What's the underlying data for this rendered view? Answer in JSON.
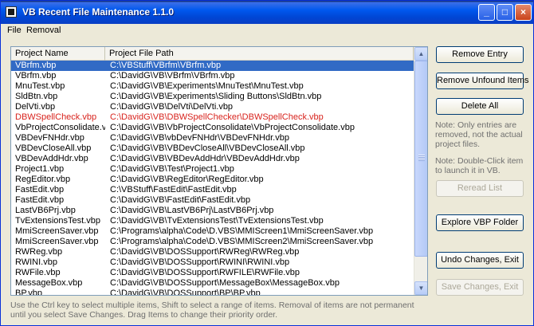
{
  "window": {
    "title": "VB Recent File Maintenance 1.1.0"
  },
  "titlebar_buttons": {
    "minimize": "_",
    "maximize": "□",
    "close": "×"
  },
  "menu": {
    "file": "File",
    "removal": "Removal"
  },
  "list": {
    "columns": [
      "Project Name",
      "Project File Path"
    ],
    "rows": [
      {
        "name": "VBrfm.vbp",
        "path": "C:\\VBStuff\\VBrfm\\VBrfm.vbp",
        "selected": true,
        "red": false
      },
      {
        "name": "VBrfm.vbp",
        "path": "C:\\DavidG\\VB\\VBrfm\\VBrfm.vbp",
        "selected": false,
        "red": false
      },
      {
        "name": "MnuTest.vbp",
        "path": "C:\\DavidG\\VB\\Experiments\\MnuTest\\MnuTest.vbp",
        "selected": false,
        "red": false
      },
      {
        "name": "SldBtn.vbp",
        "path": "C:\\DavidG\\VB\\Experiments\\Sliding Buttons\\SldBtn.vbp",
        "selected": false,
        "red": false
      },
      {
        "name": "DelVti.vbp",
        "path": "C:\\DavidG\\VB\\DelVti\\DelVti.vbp",
        "selected": false,
        "red": false
      },
      {
        "name": "DBWSpellCheck.vbp",
        "path": "C:\\DavidG\\VB\\DBWSpellChecker\\DBWSpellCheck.vbp",
        "selected": false,
        "red": true
      },
      {
        "name": "VbProjectConsolidate.vbp",
        "path": "C:\\DavidG\\VB\\VbProjectConsolidate\\VbProjectConsolidate.vbp",
        "selected": false,
        "red": false
      },
      {
        "name": "VBDevFNHdr.vbp",
        "path": "C:\\DavidG\\VB\\vbDevFNHdr\\VBDevFNHdr.vbp",
        "selected": false,
        "red": false
      },
      {
        "name": "VBDevCloseAll.vbp",
        "path": "C:\\DavidG\\VB\\VBDevCloseAll\\VBDevCloseAll.vbp",
        "selected": false,
        "red": false
      },
      {
        "name": "VBDevAddHdr.vbp",
        "path": "C:\\DavidG\\VB\\VBDevAddHdr\\VBDevAddHdr.vbp",
        "selected": false,
        "red": false
      },
      {
        "name": "Project1.vbp",
        "path": "C:\\DavidG\\VB\\Test\\Project1.vbp",
        "selected": false,
        "red": false
      },
      {
        "name": "RegEditor.vbp",
        "path": "C:\\DavidG\\VB\\RegEditor\\RegEditor.vbp",
        "selected": false,
        "red": false
      },
      {
        "name": "FastEdit.vbp",
        "path": "C:\\VBStuff\\FastEdit\\FastEdit.vbp",
        "selected": false,
        "red": false
      },
      {
        "name": "FastEdit.vbp",
        "path": "C:\\DavidG\\VB\\FastEdit\\FastEdit.vbp",
        "selected": false,
        "red": false
      },
      {
        "name": "LastVB6Prj.vbp",
        "path": "C:\\DavidG\\VB\\LastVB6Prj\\LastVB6Prj.vbp",
        "selected": false,
        "red": false
      },
      {
        "name": "TvExtensionsTest.vbp",
        "path": "C:\\DavidG\\VB\\TvExtensionsTest\\TvExtensionsTest.vbp",
        "selected": false,
        "red": false
      },
      {
        "name": "MmiScreenSaver.vbp",
        "path": "C:\\Programs\\alpha\\Code\\D.VBS\\MMIScreen1\\MmiScreenSaver.vbp",
        "selected": false,
        "red": false
      },
      {
        "name": "MmiScreenSaver.vbp",
        "path": "C:\\Programs\\alpha\\Code\\D.VBS\\MMIScreen2\\MmiScreenSaver.vbp",
        "selected": false,
        "red": false
      },
      {
        "name": "RWReg.vbp",
        "path": "C:\\DavidG\\VB\\DOSSupport\\RWReg\\RWReg.vbp",
        "selected": false,
        "red": false
      },
      {
        "name": "RWINI.vbp",
        "path": "C:\\DavidG\\VB\\DOSSupport\\RWINI\\RWINI.vbp",
        "selected": false,
        "red": false
      },
      {
        "name": "RWFile.vbp",
        "path": "C:\\DavidG\\VB\\DOSSupport\\RWFILE\\RWFile.vbp",
        "selected": false,
        "red": false
      },
      {
        "name": "MessageBox.vbp",
        "path": "C:\\DavidG\\VB\\DOSSupport\\MessageBox\\MessageBox.vbp",
        "selected": false,
        "red": false
      },
      {
        "name": "BP.vbp",
        "path": "C:\\DavidG\\VB\\DOSSupport\\BP\\BP.vbp",
        "selected": false,
        "red": false
      }
    ]
  },
  "buttons": {
    "remove_entry": "Remove Entry",
    "remove_unfound": "Remove Unfound Items",
    "delete_all": "Delete All",
    "reread_list": "Reread List",
    "explore_vbp": "Explore VBP Folder",
    "undo_changes": "Undo Changes, Exit",
    "save_changes": "Save Changes, Exit"
  },
  "notes": {
    "note1": "Note: Only entries are removed, not the actual project files.",
    "note2": "Note: Double-Click item to launch it in VB."
  },
  "status": "Use the Ctrl key to select multiple items, Shift to select a range of items. Removal of items are not permanent until you select Save Changes. Drag Items to change their priority order.",
  "colors": {
    "selection": "#316ac5",
    "missing_item": "#d8231d",
    "titlebar": "#0058ee"
  },
  "icons": {
    "app": "vb-app-icon",
    "scroll_up": "scroll-up-arrow-icon",
    "scroll_down": "scroll-down-arrow-icon"
  }
}
